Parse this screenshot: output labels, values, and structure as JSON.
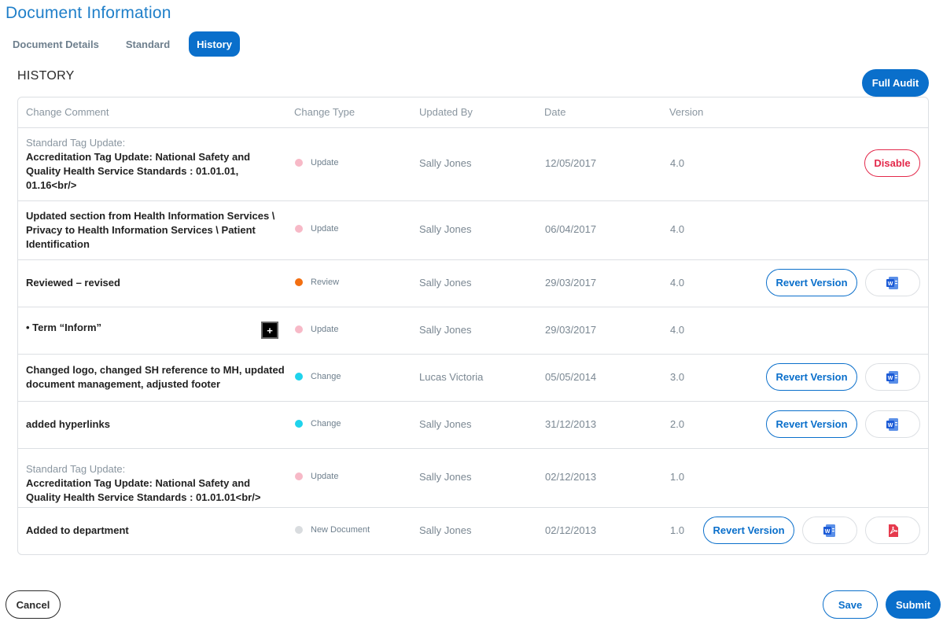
{
  "page": {
    "title": "Document Information"
  },
  "tabs": [
    {
      "label": "Document Details",
      "active": false
    },
    {
      "label": "Standard",
      "active": false
    },
    {
      "label": "History",
      "active": true
    }
  ],
  "history": {
    "title": "HISTORY",
    "full_audit_label": "Full Audit",
    "columns": [
      "Change Comment",
      "Change Type",
      "Updated By",
      "Date",
      "Version"
    ],
    "rows": [
      {
        "sub": "Standard Tag Update:",
        "comment": "Accreditation Tag Update: National Safety and Quality Health Service Standards : 01.01.01, 01.16<br/>",
        "type": "Update",
        "type_color": "#f7b9c7",
        "user": "Sally Jones",
        "date": "12/05/2017",
        "version": "4.0",
        "actions": [
          "disable"
        ]
      },
      {
        "sub": "",
        "comment": "Updated section from Health Information Services \\ Privacy to Health Information Services \\ Patient Identification",
        "type": "Update",
        "type_color": "#f7b9c7",
        "user": "Sally Jones",
        "date": "06/04/2017",
        "version": "4.0",
        "actions": []
      },
      {
        "sub": "",
        "comment": "Reviewed – revised",
        "type": "Review",
        "type_color": "#f36f11",
        "user": "Sally Jones",
        "date": "29/03/2017",
        "version": "4.0",
        "actions": [
          "revert",
          "word"
        ]
      },
      {
        "sub": "",
        "comment": "• Term “Inform”",
        "type": "Update",
        "type_color": "#f7b9c7",
        "user": "Sally Jones",
        "date": "29/03/2017",
        "version": "4.0",
        "actions": [],
        "expand": "+"
      },
      {
        "sub": "",
        "comment": "Changed logo, changed SH reference to MH, updated document management, adjusted footer",
        "type": "Change",
        "type_color": "#1fd3ec",
        "user": "Lucas Victoria",
        "date": "05/05/2014",
        "version": "3.0",
        "actions": [
          "revert",
          "word"
        ]
      },
      {
        "sub": "",
        "comment": "added hyperlinks",
        "type": "Change",
        "type_color": "#1fd3ec",
        "user": "Sally Jones",
        "date": "31/12/2013",
        "version": "2.0",
        "actions": [
          "revert",
          "word"
        ]
      },
      {
        "sub": "Standard Tag Update:",
        "comment": "Accreditation Tag Update: National Safety and Quality Health Service Standards : 01.01.01<br/>",
        "type": "Update",
        "type_color": "#f7b9c7",
        "user": "Sally Jones",
        "date": "02/12/2013",
        "version": "1.0",
        "actions": []
      },
      {
        "sub": "",
        "comment": "Added to department",
        "type": "New Document",
        "type_color": "#d9dcdf",
        "user": "Sally Jones",
        "date": "02/12/2013",
        "version": "1.0",
        "actions": [
          "revert",
          "word",
          "pdf"
        ]
      }
    ],
    "labels": {
      "revert": "Revert Version",
      "disable": "Disable"
    }
  },
  "footer": {
    "cancel_label": "Cancel",
    "save_label": "Save",
    "submit_label": "Submit"
  },
  "colors": {
    "accent": "#0a6fcb",
    "danger": "#e3294b",
    "title": "#1f7fc9"
  }
}
